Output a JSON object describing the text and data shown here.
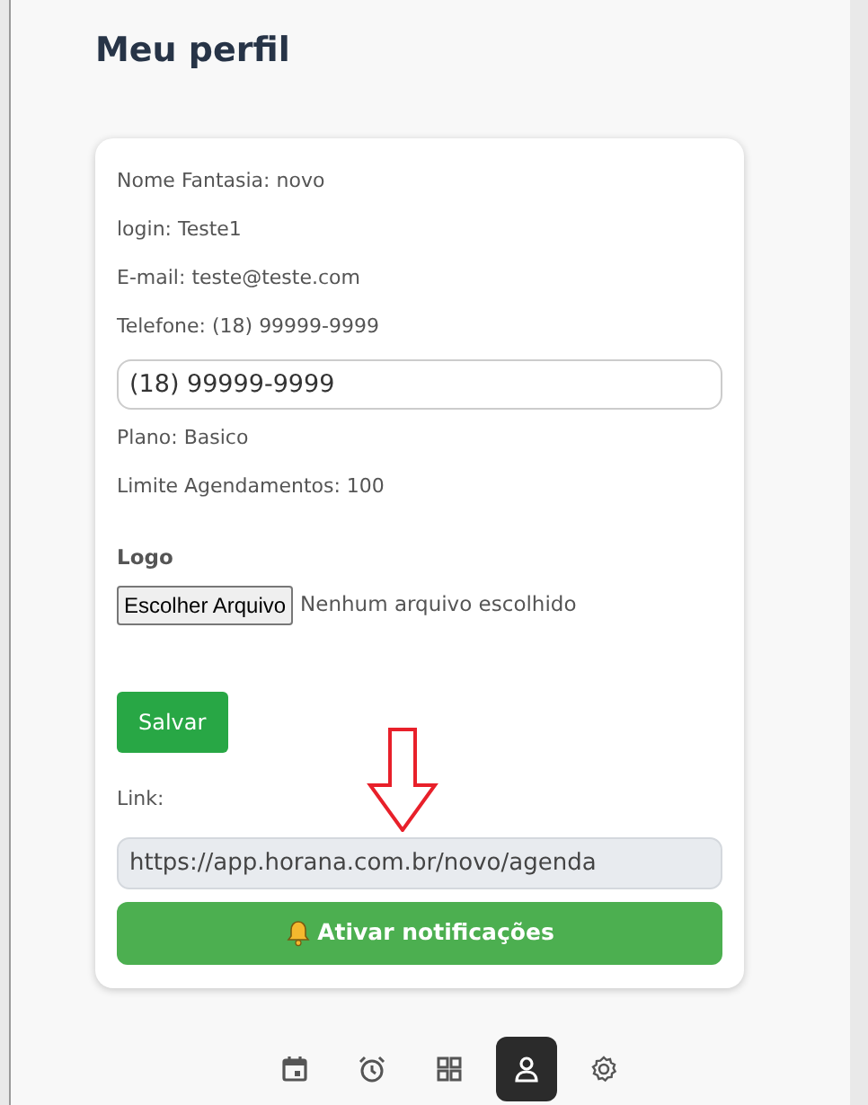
{
  "title": "Meu perfil",
  "info": [
    {
      "text": "Nome Fantasia: novo"
    },
    {
      "text": "login: Teste1"
    },
    {
      "text": "E-mail: teste@teste.com"
    },
    {
      "text": "Telefone: (18) 99999-9999"
    }
  ],
  "phone_field": {
    "value": "(18) 99999-9999"
  },
  "info2": [
    {
      "text": "Plano: Basico"
    },
    {
      "text": "Limite Agendamentos: 100"
    }
  ],
  "logo": {
    "label": "Logo",
    "button": "Escolher Arquivo",
    "status": "Nenhum arquivo escolhido"
  },
  "save_button": "Salvar",
  "link": {
    "label": "Link:",
    "value": "https://app.horana.com.br/novo/agenda"
  },
  "notify_button": "Ativar notificações",
  "bottom_nav": [
    {
      "kind": "calendar",
      "selected": false
    },
    {
      "kind": "alarm",
      "selected": false
    },
    {
      "kind": "grid",
      "selected": false
    },
    {
      "kind": "user",
      "selected": true
    },
    {
      "kind": "settings",
      "selected": false
    }
  ]
}
